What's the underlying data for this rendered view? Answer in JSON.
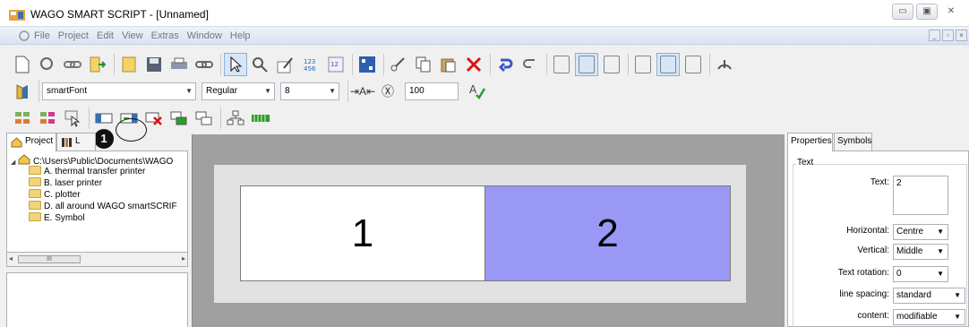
{
  "window": {
    "title": "WAGO SMART SCRIPT - [Unnamed]",
    "controls": [
      "minimize-icon",
      "maximize-icon",
      "close-icon"
    ],
    "control_glyphs": [
      "▭",
      "▣",
      "✕"
    ]
  },
  "menu": {
    "items": [
      "File",
      "Project",
      "Edit",
      "View",
      "Extras",
      "Window",
      "Help"
    ]
  },
  "font_toolbar": {
    "font_name": "smartFont",
    "font_style": "Regular",
    "font_size": "8",
    "char_spacing": "100"
  },
  "annotation": {
    "number": "1"
  },
  "left_panel": {
    "tabs": [
      "Project",
      "L"
    ],
    "tree_root": "C:\\Users\\Public\\Documents\\WAGO",
    "tree_items": [
      "A. thermal transfer printer",
      "B. laser printer",
      "C. plotter",
      "D. all around WAGO smartSCRIF",
      "E. Symbol"
    ],
    "scroll_thumb": "III"
  },
  "canvas": {
    "cells": [
      "1",
      "2"
    ],
    "selected_color": "#9999f5"
  },
  "right_panel": {
    "tabs": [
      "Properties",
      "Symbols"
    ],
    "group": "Text",
    "text_label": "Text:",
    "text_value": "2",
    "horizontal_label": "Horizontal:",
    "horizontal_value": "Centre",
    "vertical_label": "Vertical:",
    "vertical_value": "Middle",
    "rotation_label": "Text rotation:",
    "rotation_value": "0",
    "spacing_label": "line spacing:",
    "spacing_value": "standard",
    "content_label": "content:",
    "content_value": "modifiable"
  }
}
